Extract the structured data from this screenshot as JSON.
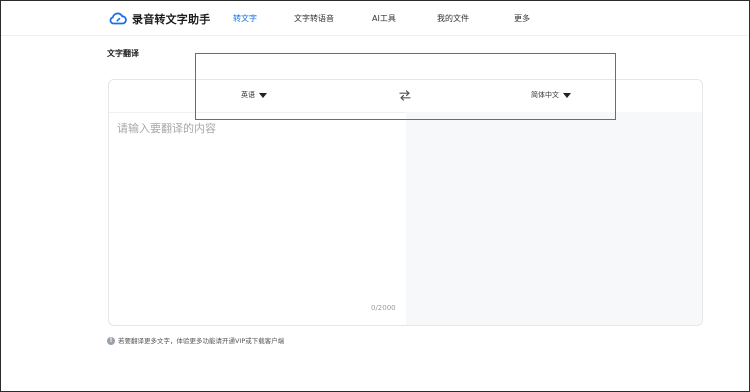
{
  "header": {
    "brand": "录音转文字助手",
    "nav": [
      {
        "label": "转文字",
        "active": true
      },
      {
        "label": "文字转语音",
        "active": false
      },
      {
        "label": "AI工具",
        "active": false
      },
      {
        "label": "我的文件",
        "active": false
      },
      {
        "label": "更多",
        "active": false
      }
    ],
    "accent_color": "#1a6fe6"
  },
  "page_title": "文字翻译",
  "translator": {
    "source_language": "英语",
    "target_language": "简体中文",
    "swap_icon": "swap-arrows-icon",
    "input_placeholder": "请输入要翻译的内容",
    "char_count": "0/2000"
  },
  "notice": {
    "icon": "info-icon",
    "icon_glyph": "!",
    "text": "若要翻译更多文字，体验更多功能请开通VIP或下载客户端"
  },
  "annotation": {
    "color": "#e03a3a"
  }
}
